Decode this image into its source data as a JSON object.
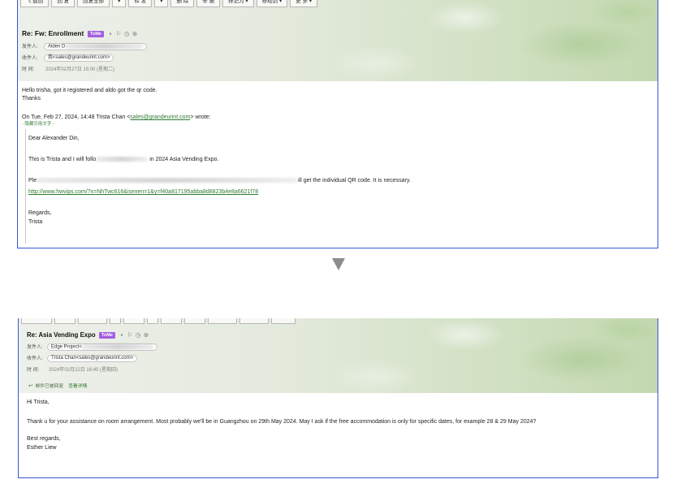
{
  "colors": {
    "border": "#3456d6",
    "link": "#2f7a32",
    "badge": "#a35ee0",
    "arrow": "#8c8c8c"
  },
  "glyphs": {
    "note": "▪",
    "flag": "⚐",
    "clock": "◷",
    "print": "⊕",
    "reply": "↩"
  },
  "top": {
    "toolbar": [
      "《 返回",
      "回 复",
      "回复全部",
      "▾",
      "转 发",
      "▾",
      "删 除",
      "举 报",
      "标记为 ▾",
      "移动到 ▾",
      "更 多 ▾"
    ],
    "subject": "Re: Fw: Enrollment",
    "badge": "ToMe",
    "from_label": "发件人:",
    "from_name": "Alden D",
    "to_label": "收件人:",
    "to_value": "我<sales@grandeurint.com>",
    "time_label": "时 间:",
    "time_value": "2024年02月27日 15:00 (星期二)",
    "body": {
      "line1": "Hello trisha, got it registered and aldo got the qr code.",
      "line2": "Thanks",
      "intro_prefix": "On Tue, Feb 27, 2024, 14:48 Trista Chan <",
      "intro_link": "sales@grandeurint.com",
      "intro_suffix": "> wrote:",
      "hide_quote": "- 隐藏引用文字 -",
      "quote": {
        "greeting": "Dear Alexander Din,",
        "p1_start": "This is Trista and I will follo",
        "p1_end": " in 2024 Asia Vending Expo.",
        "p2_start": "Ple",
        "p2_end": "ill get the individual QR code. It is necessary.",
        "link": "http://www.hwvips.com/?x=NhTwc616&isexen=1&y=f40a817195abba8d8823b4e8a6621f78",
        "signoff": "Regards,",
        "signature": "Trista"
      }
    }
  },
  "bottom": {
    "subject": "Re: Asia Vending Expo",
    "badge": "ToMe",
    "from_label": "发件人:",
    "from_name": "Edge Project<",
    "to_label": "收件人:",
    "to_value": "Trista Chan<sales@grandeurint.com>",
    "time_label": "时 间:",
    "time_value": "2024年02月22日 18:40 (星期四)",
    "notice_text": "邮件已被回复",
    "notice_link": "查看详情",
    "body": {
      "greeting": "Hi Trista,",
      "message": "Thank u for your assistance on room arrangement. Most probably we'll be in Guangzhou on 29th May 2024. May I ask if the free accommodation is only for specific dates, for example 28 & 29 May 2024?",
      "signoff": "Best regards,",
      "signature": "Esther Liew"
    }
  }
}
